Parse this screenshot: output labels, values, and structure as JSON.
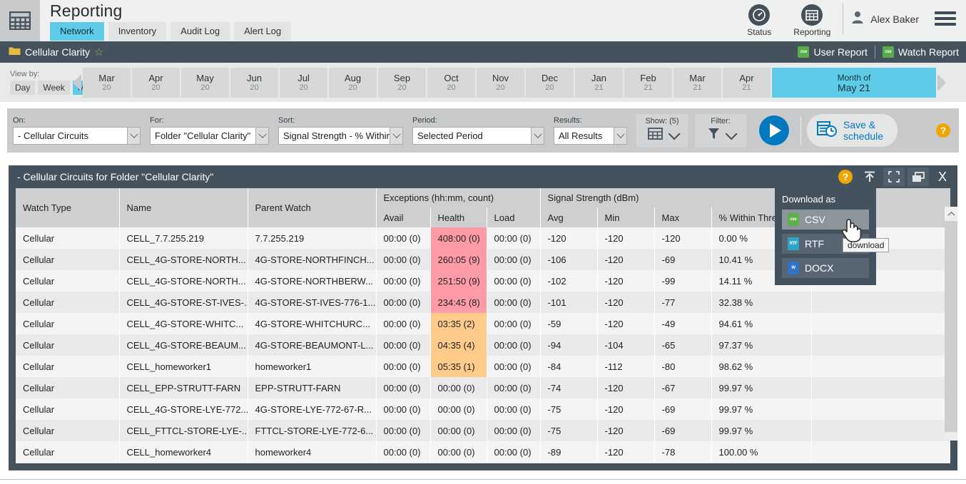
{
  "header": {
    "logo_icon": "grid-table-icon",
    "title": "Reporting",
    "tabs": [
      {
        "label": "Network",
        "active": true
      },
      {
        "label": "Inventory",
        "active": false
      },
      {
        "label": "Audit Log",
        "active": false
      },
      {
        "label": "Alert Log",
        "active": false
      }
    ],
    "actions": [
      {
        "label": "Status",
        "icon": "gauge-icon"
      },
      {
        "label": "Reporting",
        "icon": "grid-table-icon"
      }
    ],
    "user": {
      "name": "Alex Baker",
      "icon": "user-avatar-icon"
    },
    "menu_icon": "hamburger-menu-icon"
  },
  "breadcrumb": {
    "folder_icon": "folder-icon",
    "label": "Cellular Clarity",
    "star_icon": "star-outline-icon",
    "links": [
      {
        "label": "User Report",
        "icon": "csv-file-icon"
      },
      {
        "label": "Watch Report",
        "icon": "csv-file-icon"
      }
    ]
  },
  "viewbar": {
    "view_by_label": "View by:",
    "granularity": [
      {
        "label": "Day",
        "active": false
      },
      {
        "label": "Week",
        "active": false
      },
      {
        "label": "Month",
        "active": true
      }
    ],
    "prev_icon": "arrow-left-icon",
    "next_icon": "arrow-right-icon",
    "months": [
      {
        "month": "Mar",
        "year": "20"
      },
      {
        "month": "Apr",
        "year": "20"
      },
      {
        "month": "May",
        "year": "20"
      },
      {
        "month": "Jun",
        "year": "20"
      },
      {
        "month": "Jul",
        "year": "20"
      },
      {
        "month": "Aug",
        "year": "20"
      },
      {
        "month": "Sep",
        "year": "20"
      },
      {
        "month": "Oct",
        "year": "20"
      },
      {
        "month": "Nov",
        "year": "20"
      },
      {
        "month": "Dec",
        "year": "20"
      },
      {
        "month": "Jan",
        "year": "21"
      },
      {
        "month": "Feb",
        "year": "21"
      },
      {
        "month": "Mar",
        "year": "21"
      },
      {
        "month": "Apr",
        "year": "21"
      }
    ],
    "current": {
      "prefix": "Month of",
      "value": "May 21"
    }
  },
  "controls": {
    "on": {
      "label": "On:",
      "value": "- Cellular Circuits"
    },
    "for": {
      "label": "For:",
      "value": "Folder \"Cellular Clarity\""
    },
    "sort": {
      "label": "Sort:",
      "value": "Signal Strength - % Within"
    },
    "period": {
      "label": "Period:",
      "value": "Selected Period"
    },
    "results": {
      "label": "Results:",
      "value": "All Results"
    },
    "show": {
      "label": "Show: (5)",
      "icon": "grid-table-icon"
    },
    "filter": {
      "label": "Filter:",
      "icon": "funnel-icon"
    },
    "run": {
      "icon": "play-icon"
    },
    "save": {
      "line1": "Save &",
      "line2": "schedule",
      "icon": "calendar-clock-icon"
    },
    "help": {
      "icon": "help-question-icon",
      "glyph": "?"
    }
  },
  "panel": {
    "title": "- Cellular Circuits for Folder \"Cellular Clarity\"",
    "tools": [
      {
        "name": "help-question-icon",
        "glyph": "?"
      },
      {
        "name": "export-up-icon",
        "glyph": ""
      },
      {
        "name": "fullscreen-icon",
        "glyph": ""
      },
      {
        "name": "popout-window-icon",
        "glyph": ""
      },
      {
        "name": "close-icon",
        "glyph": "X"
      }
    ]
  },
  "download_menu": {
    "title": "Download as",
    "items": [
      {
        "label": "CSV",
        "icon": "csv-file-icon",
        "hover": true
      },
      {
        "label": "RTF",
        "icon": "rtf-file-icon",
        "hover": false
      },
      {
        "label": "DOCX",
        "icon": "docx-file-icon",
        "hover": false
      }
    ],
    "tooltip": "download",
    "cursor_icon": "pointing-hand-cursor"
  },
  "table": {
    "group_headers": [
      {
        "label": "Watch Type",
        "span": 1,
        "rowspan": 2
      },
      {
        "label": "Name",
        "span": 1,
        "rowspan": 2
      },
      {
        "label": "Parent Watch",
        "span": 1,
        "rowspan": 2
      },
      {
        "label": "Exceptions (hh:mm, count)",
        "span": 3
      },
      {
        "label": "Signal Strength (dBm)",
        "span": 4
      }
    ],
    "sub_headers": [
      "Avail",
      "Health",
      "Load",
      "Avg",
      "Min",
      "Max",
      "% Within Thresh"
    ],
    "rows": [
      {
        "watch_type": "Cellular",
        "name": "CELL_7.7.255.219",
        "parent": "7.7.255.219",
        "avail": "00:00 (0)",
        "health": "408:00 (0)",
        "health_state": "red",
        "load": "00:00 (0)",
        "avg": "-120",
        "min": "-120",
        "max": "-120",
        "within": "0.00 %"
      },
      {
        "watch_type": "Cellular",
        "name": "CELL_4G-STORE-NORTH...",
        "parent": "4G-STORE-NORTHFINCH...",
        "avail": "00:00 (0)",
        "health": "260:05 (9)",
        "health_state": "red",
        "load": "00:00 (0)",
        "avg": "-106",
        "min": "-120",
        "max": "-69",
        "within": "10.41 %"
      },
      {
        "watch_type": "Cellular",
        "name": "CELL_4G-STORE-NORTH...",
        "parent": "4G-STORE-NORTHBERW...",
        "avail": "00:00 (0)",
        "health": "251:50 (9)",
        "health_state": "red",
        "load": "00:00 (0)",
        "avg": "-102",
        "min": "-120",
        "max": "-99",
        "within": "14.11 %"
      },
      {
        "watch_type": "Cellular",
        "name": "CELL_4G-STORE-ST-IVES-...",
        "parent": "4G-STORE-ST-IVES-776-1...",
        "avail": "00:00 (0)",
        "health": "234:45 (8)",
        "health_state": "red",
        "load": "00:00 (0)",
        "avg": "-101",
        "min": "-120",
        "max": "-77",
        "within": "32.38 %"
      },
      {
        "watch_type": "Cellular",
        "name": "CELL_4G-STORE-WHITC...",
        "parent": "4G-STORE-WHITCHURC...",
        "avail": "00:00 (0)",
        "health": "03:35 (2)",
        "health_state": "orange",
        "load": "00:00 (0)",
        "avg": "-59",
        "min": "-120",
        "max": "-49",
        "within": "94.61 %"
      },
      {
        "watch_type": "Cellular",
        "name": "CELL_4G-STORE-BEAUM...",
        "parent": "4G-STORE-BEAUMONT-L...",
        "avail": "00:00 (0)",
        "health": "04:35 (4)",
        "health_state": "orange",
        "load": "00:00 (0)",
        "avg": "-94",
        "min": "-104",
        "max": "-65",
        "within": "97.37 %"
      },
      {
        "watch_type": "Cellular",
        "name": "CELL_homeworker1",
        "parent": "homeworker1",
        "avail": "00:00 (0)",
        "health": "05:35 (1)",
        "health_state": "orange",
        "load": "00:00 (0)",
        "avg": "-84",
        "min": "-112",
        "max": "-80",
        "within": "98.62 %"
      },
      {
        "watch_type": "Cellular",
        "name": "CELL_EPP-STRUTT-FARN",
        "parent": "EPP-STRUTT-FARN",
        "avail": "00:00 (0)",
        "health": "00:00 (0)",
        "health_state": "none",
        "load": "00:00 (0)",
        "avg": "-74",
        "min": "-120",
        "max": "-67",
        "within": "99.97 %"
      },
      {
        "watch_type": "Cellular",
        "name": "CELL_4G-STORE-LYE-772...",
        "parent": "4G-STORE-LYE-772-67-R...",
        "avail": "00:00 (0)",
        "health": "00:00 (0)",
        "health_state": "none",
        "load": "00:00 (0)",
        "avg": "-75",
        "min": "-120",
        "max": "-69",
        "within": "99.97 %"
      },
      {
        "watch_type": "Cellular",
        "name": "CELL_FTTCL-STORE-LYE-...",
        "parent": "FTTCL-STORE-LYE-772-6...",
        "avail": "00:00 (0)",
        "health": "00:00 (0)",
        "health_state": "none",
        "load": "00:00 (0)",
        "avg": "-75",
        "min": "-120",
        "max": "-69",
        "within": "99.97 %"
      },
      {
        "watch_type": "Cellular",
        "name": "CELL_homeworker4",
        "parent": "homeworker4",
        "avail": "00:00 (0)",
        "health": "00:00 (0)",
        "health_state": "none",
        "load": "00:00 (0)",
        "avg": "-89",
        "min": "-120",
        "max": "-78",
        "within": "100.00 %"
      }
    ]
  },
  "colors": {
    "accent_cyan": "#5ecbe8",
    "panel_dark": "#44525e",
    "link_blue": "#0079c1",
    "health_red": "#ff9ba7",
    "health_orange": "#ffcb8a",
    "help_orange": "#f0a500"
  }
}
